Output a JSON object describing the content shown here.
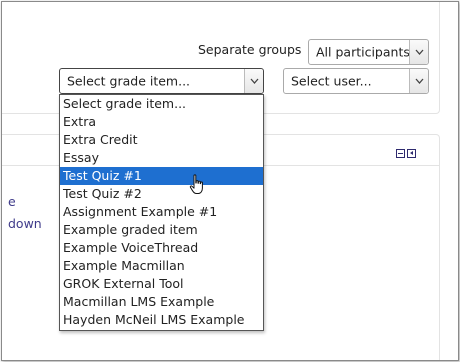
{
  "filters": {
    "groups_label": "Separate groups",
    "groups_value": "All participants",
    "grade_value": "Select grade item...",
    "user_value": "Select user..."
  },
  "dropdown": {
    "options": [
      "Select grade item...",
      "Extra",
      "Extra Credit",
      "Essay",
      "Test Quiz #1",
      "Test Quiz #2",
      "Assignment Example #1",
      "Example graded item",
      "Example VoiceThread",
      "Example Macmillan",
      "GROK External Tool",
      "Macmillan LMS Example",
      "Hayden McNeil LMS Example"
    ],
    "highlighted": "Test Quiz #1"
  },
  "background_links": {
    "line1": "e",
    "line2": "down"
  },
  "icons": {
    "select_arrow": "chevron-down-icon",
    "collapse": "minus-box-icon",
    "dock": "dock-left-icon",
    "cursor": "hand-pointer-icon"
  },
  "colors": {
    "highlight": "#1e6fd0",
    "link": "#3f3b8a"
  }
}
